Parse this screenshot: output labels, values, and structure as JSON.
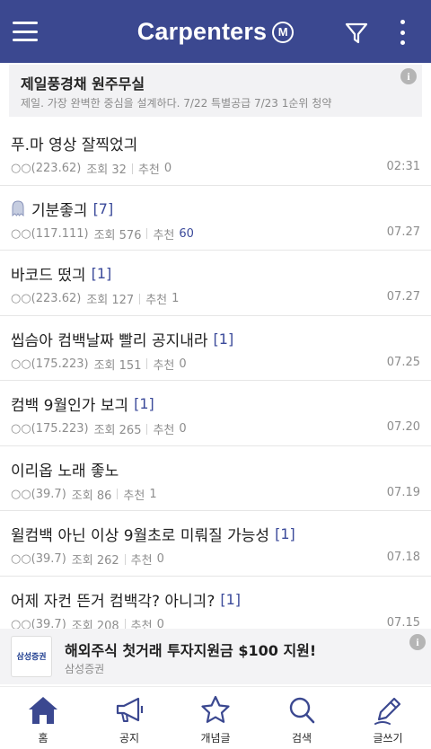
{
  "app": {
    "title": "Carpenters",
    "badge": "M",
    "accent_color": "#3b4890",
    "link_color": "#3b4a9a"
  },
  "notice": {
    "title": "제일풍경채 원주무실",
    "subtitle": "제일. 가장 완벽한 중심을 설계하다. 7/22 특별공급 7/23 1순위 청약",
    "info_icon": "i"
  },
  "posts": [
    {
      "title": "푸.마 영상 잘찍었긔",
      "comments": "",
      "ip": "○○(223.62)",
      "views": "조회 32",
      "likes_label": "추천",
      "likes": "0",
      "date": "02:31",
      "icon": "",
      "likes_highlight": false
    },
    {
      "title": "기분좋긔",
      "comments": "[7]",
      "ip": "○○(117.111)",
      "views": "조회 576",
      "likes_label": "추천",
      "likes": "60",
      "date": "07.27",
      "icon": "ghost-icon",
      "likes_highlight": true
    },
    {
      "title": "바코드 떴긔",
      "comments": "[1]",
      "ip": "○○(223.62)",
      "views": "조회 127",
      "likes_label": "추천",
      "likes": "1",
      "date": "07.27",
      "icon": "",
      "likes_highlight": false
    },
    {
      "title": "씹슴아 컴백날짜 빨리 공지내라",
      "comments": "[1]",
      "ip": "○○(175.223)",
      "views": "조회 151",
      "likes_label": "추천",
      "likes": "0",
      "date": "07.25",
      "icon": "",
      "likes_highlight": false
    },
    {
      "title": "컴백 9월인가 보긔",
      "comments": "[1]",
      "ip": "○○(175.223)",
      "views": "조회 265",
      "likes_label": "추천",
      "likes": "0",
      "date": "07.20",
      "icon": "",
      "likes_highlight": false
    },
    {
      "title": "이리옵 노래 좋노",
      "comments": "",
      "ip": "○○(39.7)",
      "views": "조회 86",
      "likes_label": "추천",
      "likes": "1",
      "date": "07.19",
      "icon": "",
      "likes_highlight": false
    },
    {
      "title": "윌컴백 아닌 이상 9월초로 미뤄질 가능성",
      "comments": "[1]",
      "ip": "○○(39.7)",
      "views": "조회 262",
      "likes_label": "추천",
      "likes": "0",
      "date": "07.18",
      "icon": "",
      "likes_highlight": false
    },
    {
      "title": "어제 자컨 뜬거 컴백각? 아니긔?",
      "comments": "[1]",
      "ip": "○○(39.7)",
      "views": "조회 208",
      "likes_label": "추천",
      "likes": "0",
      "date": "07.15",
      "icon": "",
      "likes_highlight": false
    }
  ],
  "ad": {
    "logo_text": "삼성증권",
    "title": "해외주식 첫거래 투자지원금 $100 지원!",
    "sponsor": "삼성증권"
  },
  "tabs": [
    {
      "label": "홈",
      "icon": "home-icon",
      "active": true
    },
    {
      "label": "공지",
      "icon": "megaphone-icon",
      "active": false
    },
    {
      "label": "개념글",
      "icon": "star-icon",
      "active": false
    },
    {
      "label": "검색",
      "icon": "search-icon",
      "active": false
    },
    {
      "label": "글쓰기",
      "icon": "pencil-icon",
      "active": false
    }
  ]
}
